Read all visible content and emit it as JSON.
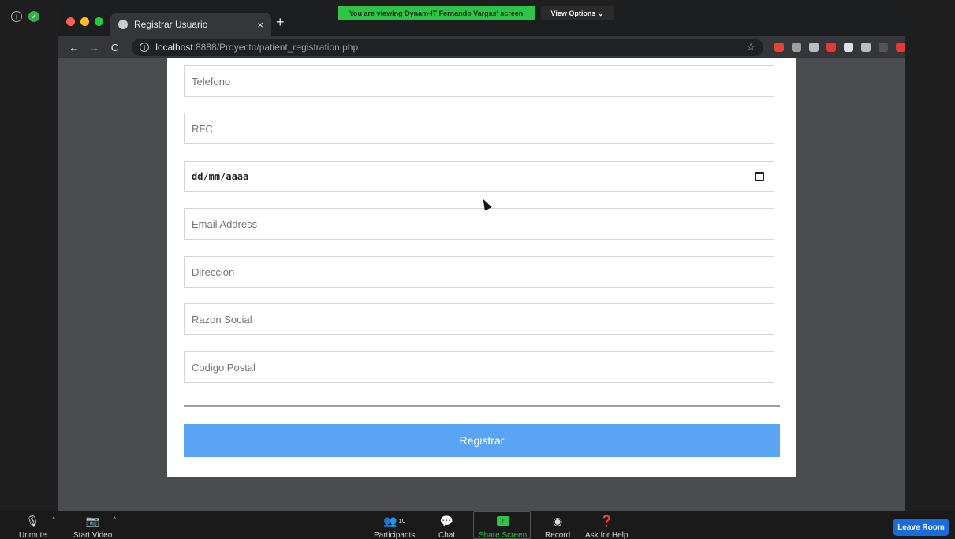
{
  "zoom": {
    "banner_text": "You are viewing Dynam-IT Fernando Vargas' screen",
    "view_options_label": "View Options ⌄",
    "controls": {
      "unmute": "Unmute",
      "start_video": "Start Video",
      "participants": "Participants",
      "participants_count": "10",
      "chat": "Chat",
      "share_screen": "Share Screen",
      "record": "Record",
      "ask_for_help": "Ask for Help",
      "leave_room": "Leave Room"
    }
  },
  "browser": {
    "tab_title": "Registrar Usuario",
    "tab_close": "×",
    "new_tab": "+",
    "url_host": "localhost",
    "url_path": ":8888/Proyecto/patient_registration.php",
    "ext_colors": [
      "#e94235",
      "#9e9e9e",
      "#bdbdbd",
      "#e53935",
      "#e0e0e0",
      "#bdbdbd",
      "#555555",
      "#e53935"
    ]
  },
  "form": {
    "telefono_placeholder": "Telefono",
    "rfc_placeholder": "RFC",
    "date_placeholder": "dd/mm/aaaa",
    "email_placeholder": "Email Address",
    "direccion_placeholder": "Direccion",
    "razon_social_placeholder": "Razon Social",
    "codigo_postal_placeholder": "Codigo Postal",
    "submit_label": "Registrar"
  },
  "colors": {
    "submit_bg": "#5aa4f4",
    "share_green": "#2ec448",
    "leave_blue": "#1a6cd8"
  }
}
